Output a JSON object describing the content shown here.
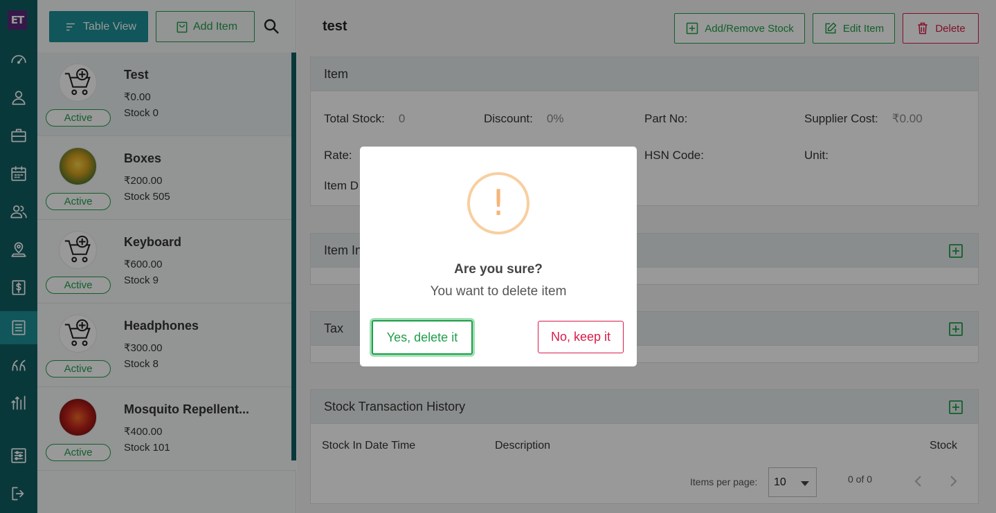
{
  "app": {
    "logo_text": "ET"
  },
  "rail": {
    "icons": [
      "speedometer-icon",
      "person-icon",
      "briefcase-icon",
      "calendar-icon",
      "people-icon",
      "location-person-icon",
      "dollar-icon",
      "list-icon",
      "quote-icon",
      "chart-bars-icon",
      "sliders-icon",
      "logout-icon"
    ],
    "active": "list-icon"
  },
  "list_toolbar": {
    "table_view_label": "Table View",
    "add_item_label": "Add Item"
  },
  "items": [
    {
      "name": "Test",
      "price": "₹0.00",
      "stock": "Stock 0",
      "status": "Active",
      "image": "cart-icon"
    },
    {
      "name": "Boxes",
      "price": "₹200.00",
      "stock": "Stock 505",
      "status": "Active",
      "image": "yellow-flower-photo"
    },
    {
      "name": "Keyboard",
      "price": "₹600.00",
      "stock": "Stock 9",
      "status": "Active",
      "image": "cart-icon"
    },
    {
      "name": "Headphones",
      "price": "₹300.00",
      "stock": "Stock 8",
      "status": "Active",
      "image": "cart-icon"
    },
    {
      "name": "Mosquito Repellent...",
      "price": "₹400.00",
      "stock": "Stock 101",
      "status": "Active",
      "image": "red-flower-photo"
    }
  ],
  "detail": {
    "title": "test",
    "actions": {
      "add_remove_stock": "Add/Remove Stock",
      "edit_item": "Edit Item",
      "delete": "Delete"
    },
    "item_section": {
      "heading": "Item",
      "total_stock_label": "Total Stock:",
      "total_stock_value": "0",
      "discount_label": "Discount:",
      "discount_value": "0%",
      "part_no_label": "Part No:",
      "supplier_cost_label": "Supplier Cost:",
      "supplier_cost_value": "₹0.00",
      "rate_label": "Rate:",
      "hsn_label": "HSN Code:",
      "unit_label": "Unit:",
      "item_desc_label": "Item D"
    },
    "item_info_heading": "Item In",
    "tax_heading": "Tax",
    "stock_history": {
      "heading": "Stock Transaction History",
      "columns": [
        "Stock In Date Time",
        "Description",
        "Stock"
      ],
      "items_per_page_label": "Items per page:",
      "items_per_page_value": "10",
      "range": "0 of 0"
    }
  },
  "modal": {
    "icon": "!",
    "title": "Are you sure?",
    "text": "You want to delete item",
    "confirm_label": "Yes, delete it",
    "cancel_label": "No, keep it"
  },
  "colors": {
    "teal": "#0f5e63",
    "teal_light": "#1b8f96",
    "green": "#1e9e4a",
    "red": "#d81b4a",
    "warn": "#f8cfa0"
  }
}
